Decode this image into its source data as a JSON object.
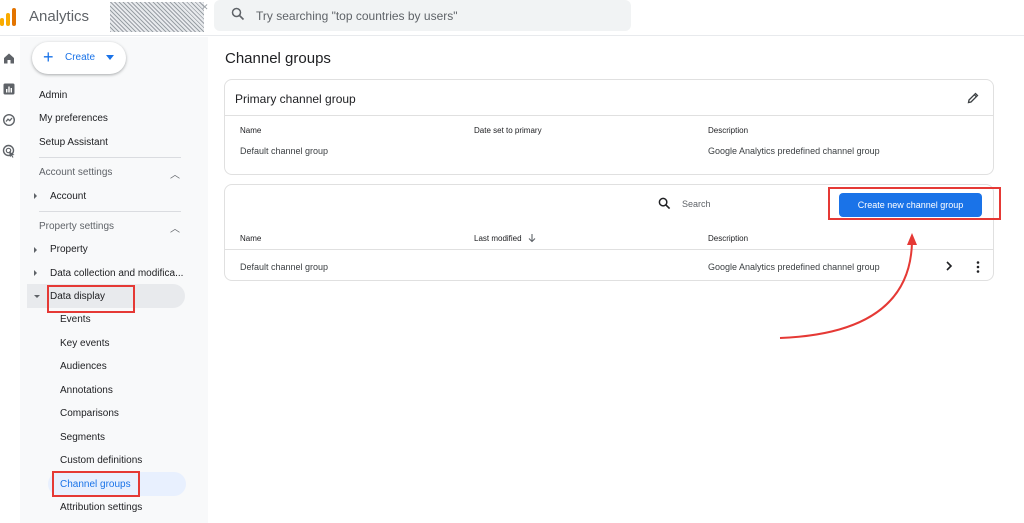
{
  "app": {
    "title": "Analytics",
    "brand_colors": [
      "#f9ab00",
      "#e37400"
    ]
  },
  "search": {
    "placeholder": "Try searching \"top countries by users\"",
    "icon": "search-icon"
  },
  "rail": {
    "icons": [
      "home-icon",
      "reports-icon",
      "explore-icon",
      "advertising-icon"
    ]
  },
  "sidenav": {
    "create_label": "Create",
    "items": {
      "admin": "Admin",
      "preferences": "My preferences",
      "setup": "Setup Assistant"
    },
    "account_section": "Account settings",
    "account": "Account",
    "property_section": "Property settings",
    "property": "Property",
    "data_collection": "Data collection and modifica...",
    "data_display": "Data display",
    "data_display_items": [
      "Events",
      "Key events",
      "Audiences",
      "Annotations",
      "Comparisons",
      "Segments",
      "Custom definitions",
      "Channel groups",
      "Attribution settings"
    ]
  },
  "main": {
    "page_title": "Channel groups",
    "primary": {
      "title": "Primary channel group",
      "columns": [
        "Name",
        "Date set to primary",
        "Description"
      ],
      "row": {
        "name": "Default channel group",
        "date": "",
        "description": "Google Analytics predefined channel group"
      }
    },
    "table": {
      "search_placeholder": "Search",
      "create_button": "Create new channel group",
      "columns": [
        "Name",
        "Last modified",
        "Description"
      ],
      "rows": [
        {
          "name": "Default channel group",
          "last_modified": "",
          "description": "Google Analytics predefined channel group"
        }
      ]
    }
  },
  "colors": {
    "accent": "#1a73e8",
    "highlight": "#e53935"
  }
}
